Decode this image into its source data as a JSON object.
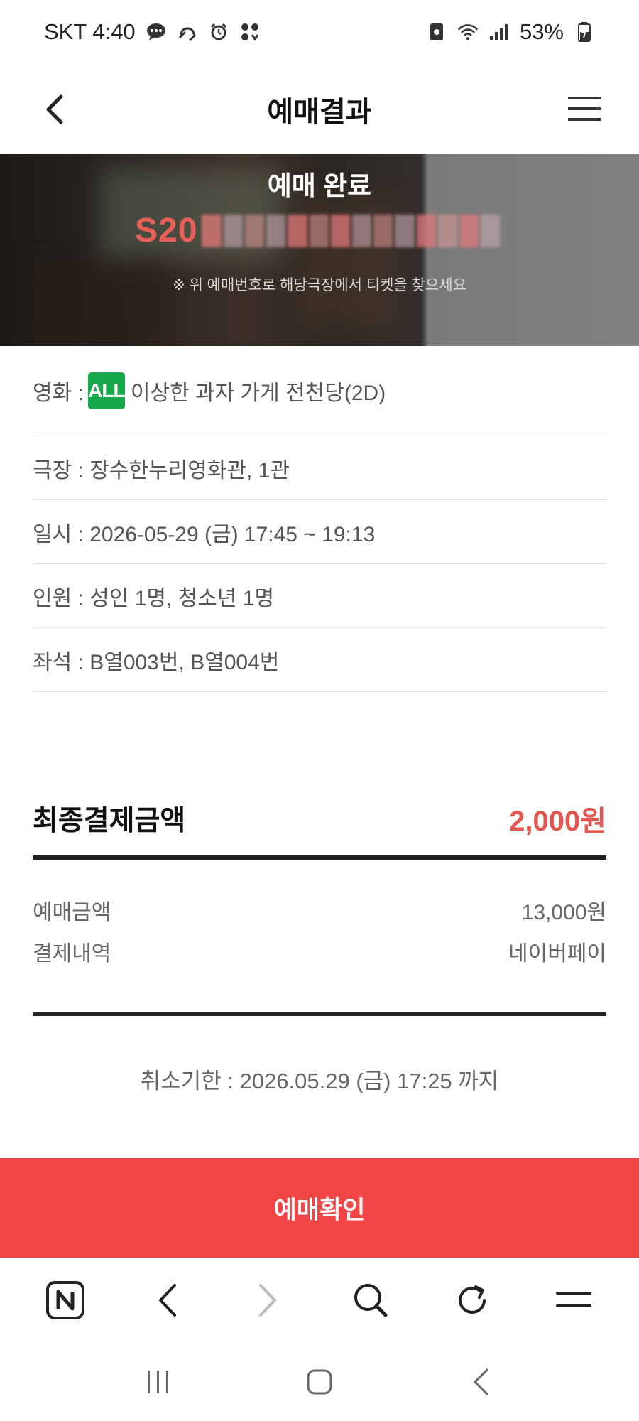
{
  "status_bar": {
    "carrier_time": "SKT 4:40",
    "battery": "53%",
    "icons": [
      "message-icon",
      "headset-icon",
      "alarm-icon",
      "app-dots-icon",
      "sim-icon",
      "wifi-icon",
      "signal-icon",
      "battery-icon"
    ]
  },
  "header": {
    "title": "예매결과"
  },
  "banner": {
    "title": "예매 완료",
    "booking_number_visible": "S20",
    "note": "※ 위 예매번호로 해당극장에서 티켓을 찾으세요"
  },
  "details": {
    "movie_label": "영화 : ",
    "movie_rating": "ALL",
    "movie_title": "이상한 과자 가게 전천당(2D)",
    "theater": "극장 : 장수한누리영화관, 1관",
    "datetime": "일시 : 2026-05-29 (금) 17:45 ~ 19:13",
    "people": "인원 : 성인 1명, 청소년 1명",
    "seats": "좌석 : B열003번, B열004번"
  },
  "payment": {
    "final_label": "최종결제금액",
    "final_amount": "2,000원",
    "lines": [
      {
        "label": "예매금액",
        "value": "13,000원"
      },
      {
        "label": "결제내역",
        "value": "네이버페이"
      }
    ]
  },
  "cancel_deadline": "취소기한 : 2026.05.29 (금) 17:25 까지",
  "confirm_button": "예매확인",
  "colors": {
    "accent_red": "#e2564f",
    "button_red": "#f24545",
    "rating_green": "#17a84a"
  }
}
